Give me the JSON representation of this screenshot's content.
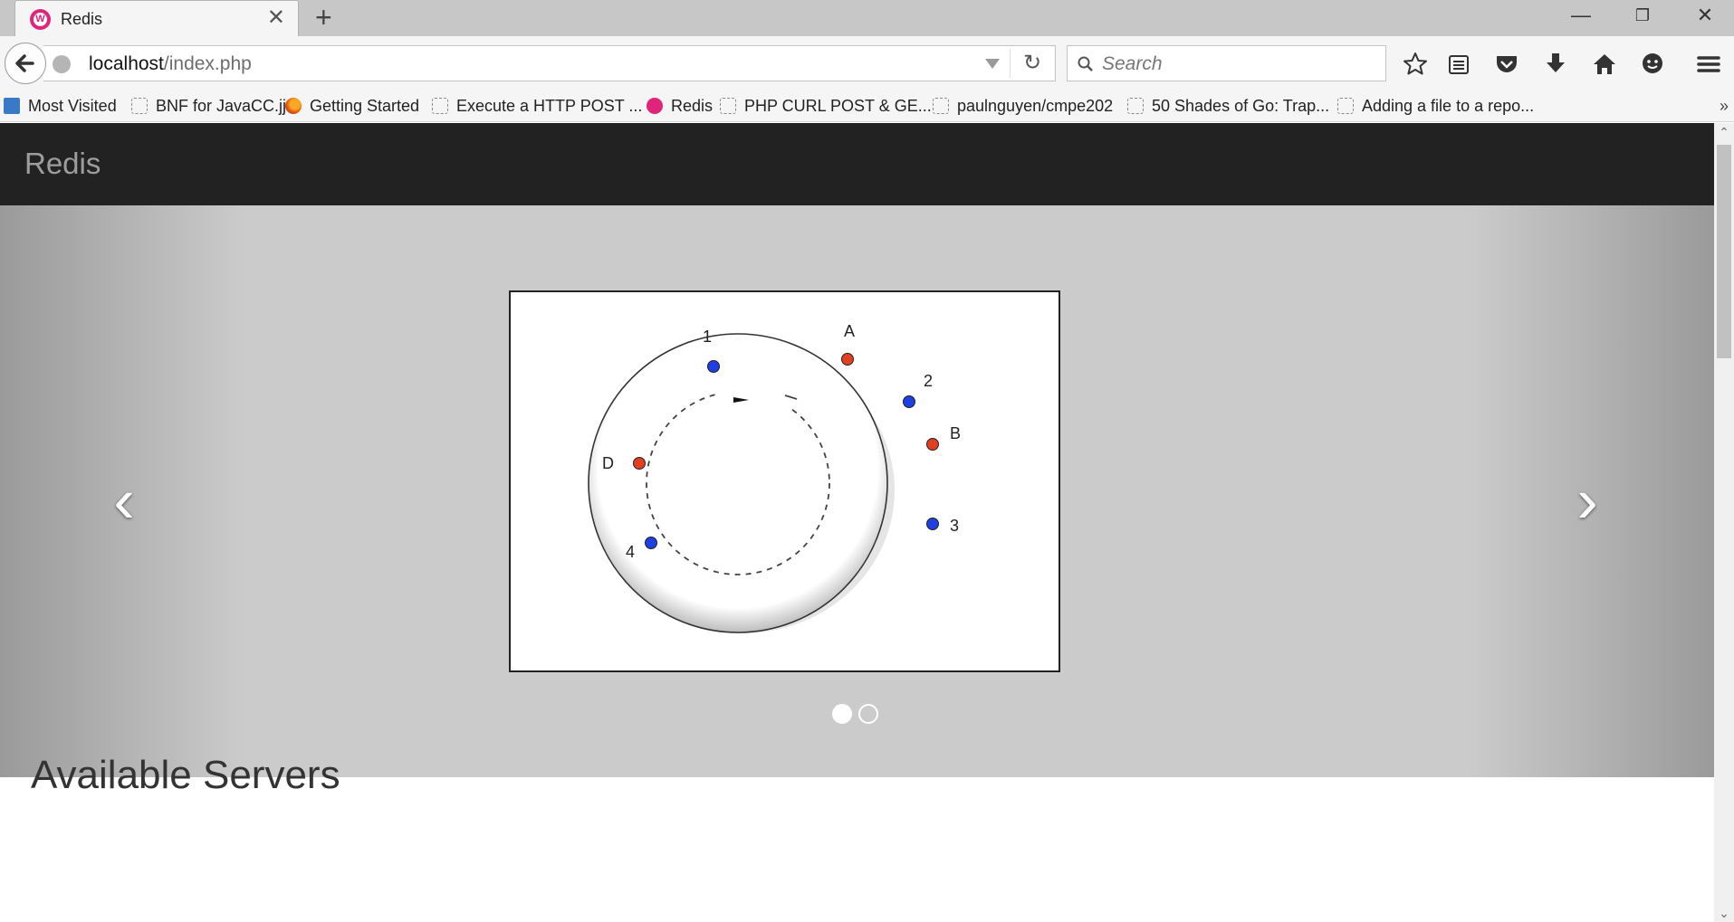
{
  "browser": {
    "tab": {
      "title": "Redis",
      "favicon": "wamp-favicon-icon"
    },
    "url": {
      "host": "localhost",
      "path": "/index.php"
    },
    "search_placeholder": "Search",
    "bookmarks": [
      {
        "label": "Most Visited",
        "icon": "most-visited-icon"
      },
      {
        "label": "BNF for JavaCC.jj",
        "icon": "blank-page-icon"
      },
      {
        "label": "Getting Started",
        "icon": "firefox-icon"
      },
      {
        "label": "Execute a HTTP POST ...",
        "icon": "blank-page-icon"
      },
      {
        "label": "Redis",
        "icon": "wamp-favicon-icon"
      },
      {
        "label": "PHP CURL POST & GE...",
        "icon": "blank-page-icon"
      },
      {
        "label": "paulnguyen/cmpe202",
        "icon": "blank-page-icon"
      },
      {
        "label": "50 Shades of Go: Trap...",
        "icon": "blank-page-icon"
      },
      {
        "label": "Adding a file to a repo...",
        "icon": "blank-page-icon"
      }
    ]
  },
  "page": {
    "brand": "Redis",
    "carousel": {
      "active_index": 0,
      "slide_count": 2,
      "ring_labels": {
        "n1": "1",
        "n2": "2",
        "n3": "3",
        "n4": "4",
        "a": "A",
        "b": "B",
        "d": "D"
      },
      "colors": {
        "server_node": "#1f3fe0",
        "key_node": "#e04020"
      }
    },
    "section_heading": "Available Servers"
  },
  "colors": {
    "navbar": "#222222",
    "carousel_bg": "#cbcbcb",
    "brand_text": "#9d9d9d",
    "wamp_pink": "#e0247a"
  }
}
